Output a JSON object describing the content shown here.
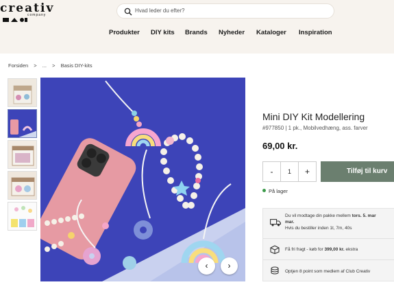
{
  "brand": {
    "logo_text": "creativ",
    "logo_sub": "company"
  },
  "search": {
    "placeholder": "Hvad leder du efter?"
  },
  "nav": {
    "items": [
      "Produkter",
      "DIY kits",
      "Brands",
      "Nyheder",
      "Kataloger",
      "Inspiration"
    ]
  },
  "breadcrumb": {
    "items": [
      "Forsiden",
      ">",
      "...",
      ">",
      "Basis DIY-kits"
    ]
  },
  "gallery": {
    "thumbnail_count": 5,
    "image_alt": "Mini DIY Kit Modellering product photo",
    "prev_symbol": "‹",
    "next_symbol": "›"
  },
  "product": {
    "title": "Mini DIY Kit Modellering",
    "sku_line": "#977850 | 1 pk., Mobilvedhæng, ass. farver",
    "price": "69,00 kr.",
    "quantity": "1",
    "minus": "-",
    "plus": "+",
    "add_to_cart": "Tilføj til kurv",
    "stock": "På lager"
  },
  "info": {
    "delivery_prefix": "Du vil modtage din pakke mellem",
    "delivery_bold": "tors. 5. mar",
    "delivery_bold2": "mar.",
    "delivery_line2": "Hvis du bestiller inden 1t, 7m, 40s",
    "shipping_prefix": "Få fri fragt - køb for",
    "shipping_bold": "399,00 kr.",
    "shipping_suffix": "ekstra",
    "points": "Optjen 8 point som medlem af  Club Creativ"
  },
  "colors": {
    "header_bg": "#f7f3ee",
    "cart_button": "#6b7f6f",
    "image_blue": "#3d44b8",
    "stock_green": "#3c9a4a"
  }
}
